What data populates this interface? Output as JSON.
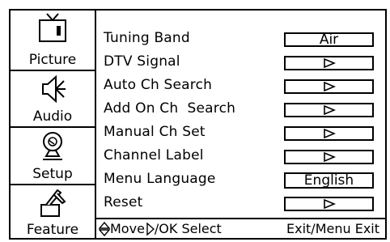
{
  "sidebar": {
    "tabs": [
      {
        "label": "Picture",
        "icon": "tv-icon"
      },
      {
        "label": "Audio",
        "icon": "speaker-icon"
      },
      {
        "label": "Setup",
        "icon": "satellite-dish-icon"
      },
      {
        "label": "Feature",
        "icon": "tools-icon"
      }
    ]
  },
  "menu": {
    "items": [
      {
        "label": "Tuning Band",
        "value": "Air"
      },
      {
        "label": "DTV Signal",
        "value": "arrow-right-icon"
      },
      {
        "label": "Auto Ch Search",
        "value": "arrow-right-icon"
      },
      {
        "label": "Add On Ch  Search",
        "value": "arrow-right-icon"
      },
      {
        "label": "Manual Ch Set",
        "value": "arrow-right-icon"
      },
      {
        "label": "Channel Label",
        "value": "arrow-right-icon"
      },
      {
        "label": "Menu Language",
        "value": "English"
      },
      {
        "label": "Reset",
        "value": "arrow-right-icon"
      }
    ]
  },
  "footer": {
    "move": "Move",
    "ok_select": "/OK Select",
    "exit": "Exit/Menu Exit"
  }
}
